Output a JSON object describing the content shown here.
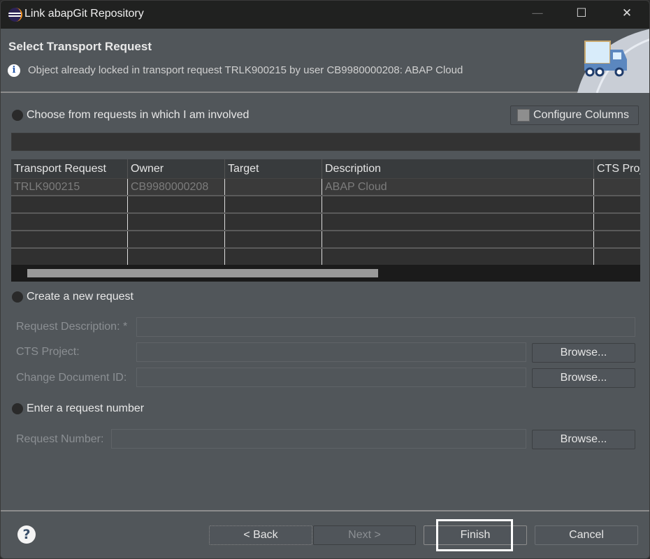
{
  "window": {
    "title": "Link abapGit Repository",
    "controls": {
      "minimize": "—",
      "maximize": "☐",
      "close": "✕"
    }
  },
  "header": {
    "title": "Select Transport Request",
    "message": "Object already locked in transport request TRLK900215 by user CB9980000208: ABAP Cloud",
    "info_icon": "i"
  },
  "choose": {
    "label": "Choose from requests in which I am involved",
    "configure_label": "Configure Columns",
    "columns": [
      "Transport Request",
      "Owner",
      "Target",
      "Description",
      "CTS Proj"
    ],
    "rows": [
      [
        "TRLK900215",
        "CB9980000208",
        "",
        "ABAP Cloud",
        ""
      ],
      [
        "",
        "",
        "",
        "",
        ""
      ],
      [
        "",
        "",
        "",
        "",
        ""
      ],
      [
        "",
        "",
        "",
        "",
        ""
      ],
      [
        "",
        "",
        "",
        "",
        ""
      ]
    ]
  },
  "create": {
    "label": "Create a new request",
    "desc_label": "Request Description: *",
    "cts_label": "CTS Project:",
    "cd_label": "Change Document ID:",
    "browse": "Browse..."
  },
  "enter": {
    "label": "Enter a request number",
    "number_label": "Request Number:",
    "browse": "Browse..."
  },
  "footer": {
    "help": "?",
    "back": "< Back",
    "back_mnemonic": "B",
    "next": "Next >",
    "finish": "Finish",
    "cancel": "Cancel"
  }
}
